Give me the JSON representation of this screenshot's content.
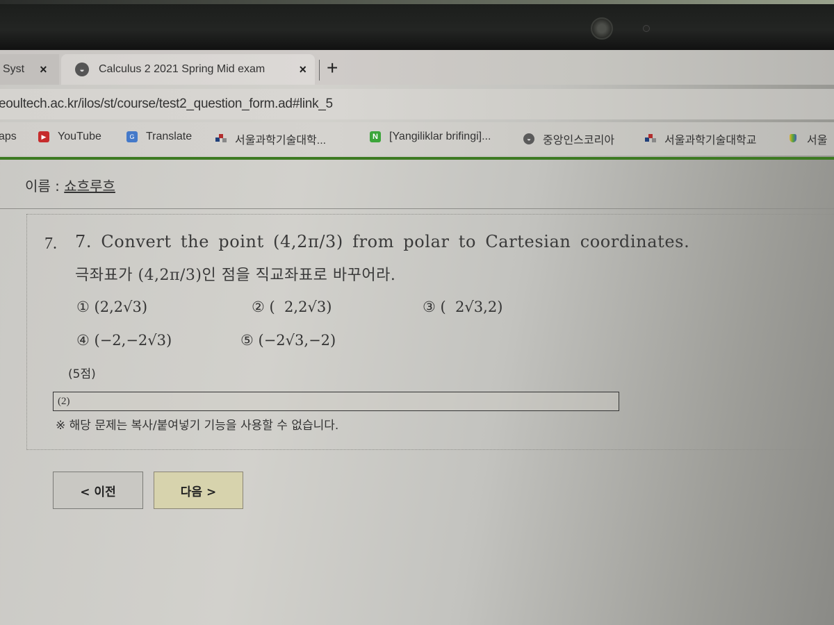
{
  "browser": {
    "tabs": [
      {
        "label": "Syst",
        "close": "×"
      },
      {
        "label": "Calculus 2 2021 Spring Mid exam",
        "close": "×",
        "icon": "globe-icon",
        "active": true
      }
    ],
    "new_tab": "+",
    "url": "eoultech.ac.kr/ilos/st/course/test2_question_form.ad#link_5",
    "bookmarks": [
      {
        "label": "aps",
        "icon": ""
      },
      {
        "label": "YouTube",
        "icon": "youtube-icon"
      },
      {
        "label": "Translate",
        "icon": "translate-icon"
      },
      {
        "label": "서울과학기술대학...",
        "icon": "seoultech-icon"
      },
      {
        "label": "[Yangiliklar brifingi]...",
        "icon": "naver-icon"
      },
      {
        "label": "중앙인스코리아",
        "icon": "globe-icon"
      },
      {
        "label": "서울과학기술대학교",
        "icon": "seoultech-icon"
      },
      {
        "label": "서울",
        "icon": "hand-icon"
      }
    ],
    "accent_color": "#3d7a22"
  },
  "page": {
    "name_label": "이름 : ",
    "name_value": "쇼흐루흐",
    "question": {
      "outer_number": "7.",
      "text_en": "7. Convert the point (4,2π/3) from polar to Cartesian coordinates.",
      "text_ko": "극좌표가 (4,2π/3)인 점을 직교좌표로 바꾸어라.",
      "options": [
        {
          "marker": "①",
          "value": "(2,2√3)"
        },
        {
          "marker": "②",
          "value": "(  2,2√3)"
        },
        {
          "marker": "③",
          "value": "(  2√3,2)"
        },
        {
          "marker": "④",
          "value": "(−2,−2√3)"
        },
        {
          "marker": "⑤",
          "value": "(−2√3,−2)"
        }
      ],
      "points": "(5점)",
      "answer_value": "(2)",
      "notice": "※ 해당 문제는 복사/붙여넣기 기능을 사용할 수 없습니다."
    },
    "nav": {
      "prev_label": "< 이전",
      "next_label": "다음 >"
    }
  }
}
